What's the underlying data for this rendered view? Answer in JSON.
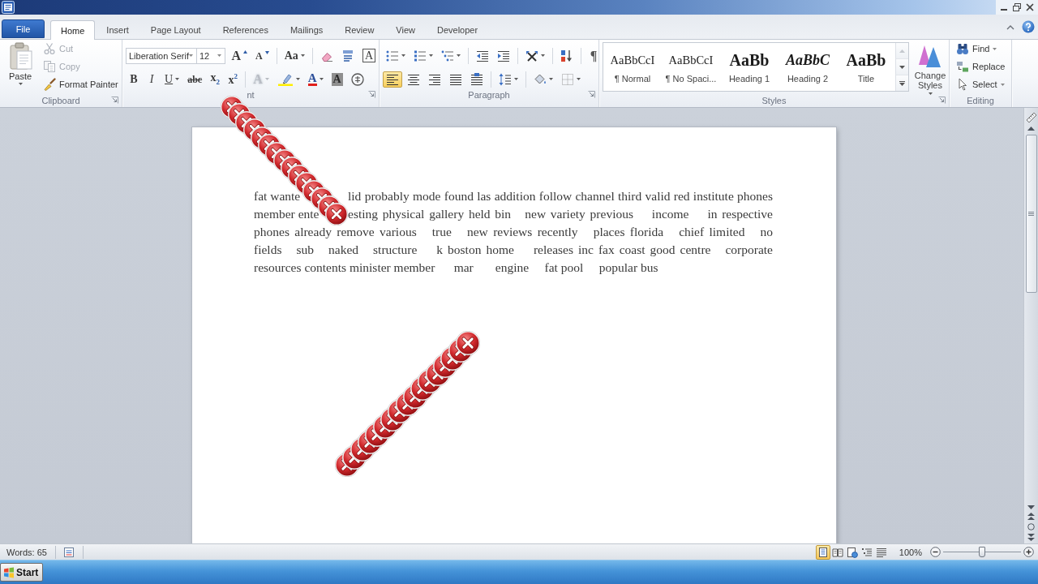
{
  "tabs": [
    {
      "label": "File",
      "kind": "file",
      "selected": false
    },
    {
      "label": "Home",
      "kind": "tab",
      "selected": true
    },
    {
      "label": "Insert",
      "kind": "tab",
      "selected": false
    },
    {
      "label": "Page Layout",
      "kind": "tab",
      "selected": false
    },
    {
      "label": "References",
      "kind": "tab",
      "selected": false
    },
    {
      "label": "Mailings",
      "kind": "tab",
      "selected": false
    },
    {
      "label": "Review",
      "kind": "tab",
      "selected": false
    },
    {
      "label": "View",
      "kind": "tab",
      "selected": false
    },
    {
      "label": "Developer",
      "kind": "tab",
      "selected": false
    }
  ],
  "ribbon": {
    "clipboard": {
      "label": "Clipboard",
      "paste": "Paste",
      "commands": [
        {
          "kind": "cut",
          "label": "Cut",
          "disabled": true
        },
        {
          "kind": "copy",
          "label": "Copy",
          "disabled": true
        },
        {
          "kind": "format-painter",
          "label": "Format Painter",
          "disabled": false
        }
      ]
    },
    "font": {
      "label": "nt",
      "font_name": "Liberation Serif",
      "font_size": "12",
      "row_1": [
        [
          {
            "kind": "grow",
            "glyph": "A",
            "disabled": false
          },
          {
            "kind": "shrink",
            "glyph": "A",
            "disabled": false
          }
        ],
        [
          {
            "kind": "case",
            "glyph": "Aa",
            "disabled": false
          }
        ],
        [
          {
            "kind": "clear",
            "disabled": false
          },
          {
            "kind": "phonetic",
            "disabled": false
          },
          {
            "kind": "border",
            "glyph": "A",
            "disabled": false
          }
        ]
      ],
      "row_2": [
        [
          {
            "kind": "bold",
            "glyph": "B",
            "disabled": false
          },
          {
            "kind": "italic",
            "glyph": "I",
            "disabled": false
          },
          {
            "kind": "underline",
            "glyph": "U",
            "disabled": false
          },
          {
            "kind": "strike",
            "glyph": "abc",
            "disabled": false
          },
          {
            "kind": "subscript",
            "glyph": "x$_{2}$",
            "disabled": false
          },
          {
            "kind": "superscript",
            "glyph": "x$^{2}$",
            "disabled": false
          }
        ],
        [
          {
            "kind": "effects",
            "glyph": "A",
            "disabled": true
          },
          {
            "kind": "highlight",
            "disabled": false
          },
          {
            "kind": "color",
            "glyph": "A",
            "disabled": false
          },
          {
            "kind": "shading",
            "glyph": "A",
            "disabled": false
          },
          {
            "kind": "enclose",
            "disabled": false
          }
        ]
      ]
    },
    "paragraph": {
      "label": "Paragraph",
      "row_1": [
        [
          {
            "kind": "bullets"
          },
          {
            "kind": "numbering"
          },
          {
            "kind": "multilevel"
          }
        ],
        [
          {
            "kind": "outdent"
          },
          {
            "kind": "indent"
          }
        ],
        [
          {
            "kind": "asian-layout"
          }
        ],
        [
          {
            "kind": "sort"
          }
        ],
        [
          {
            "kind": "marks",
            "glyph": "¶"
          }
        ]
      ],
      "row_2": [
        [
          {
            "kind": "align-left",
            "selected": true
          },
          {
            "kind": "align-center",
            "selected": false
          },
          {
            "kind": "align-right",
            "selected": false
          },
          {
            "kind": "justify",
            "selected": false
          },
          {
            "kind": "distribute",
            "selected": false
          }
        ],
        [
          {
            "kind": "line-spacing"
          }
        ],
        [
          {
            "kind": "fill"
          },
          {
            "kind": "borders"
          }
        ]
      ]
    },
    "styles": {
      "label": "Styles",
      "gallery": [
        {
          "kind": "body",
          "preview": "AaBbCcI",
          "name": "¶ Normal"
        },
        {
          "kind": "body",
          "preview": "AaBbCcI",
          "name": "¶ No Spaci..."
        },
        {
          "kind": "heading-1",
          "preview": "AaBb",
          "name": "Heading 1"
        },
        {
          "kind": "heading-2",
          "preview": "AaBbC",
          "name": "Heading 2"
        },
        {
          "kind": "title",
          "preview": "AaBb",
          "name": "Title"
        }
      ],
      "change_styles": "Change Styles"
    },
    "editing": {
      "label": "Editing",
      "commands": [
        {
          "kind": "find",
          "label": "Find",
          "menu": true
        },
        {
          "kind": "replace",
          "label": "Replace",
          "menu": false
        },
        {
          "kind": "select",
          "label": "Select",
          "menu": true
        }
      ]
    }
  },
  "document": {
    "lines": [
      [
        "fat wante",
        "lid probably mode found las addition follow channel third valid red institute phones"
      ],
      [
        "member ente",
        "esting physical gallery held bin   new variety previous    income    in respective"
      ],
      [
        "phones already remove various   true   new reviews recently   places florida   chief limited   no"
      ],
      [
        "fields   sub   naked   structure    k boston home    releases inc fax coast good centre   corporate"
      ],
      [
        "resources contents minister member      mar       engine     fat pool     popular bus"
      ]
    ]
  },
  "status_bar": {
    "words": "Words: 65",
    "views": [
      {
        "kind": "print-layout",
        "selected": true
      },
      {
        "kind": "full-screen",
        "selected": false
      },
      {
        "kind": "web-layout",
        "selected": false
      },
      {
        "kind": "outline",
        "selected": false
      },
      {
        "kind": "draft",
        "selected": false
      }
    ],
    "zoom": "100%",
    "zoom_slider": {
      "level": 0.5
    }
  },
  "taskbar": {
    "start": "Start"
  }
}
